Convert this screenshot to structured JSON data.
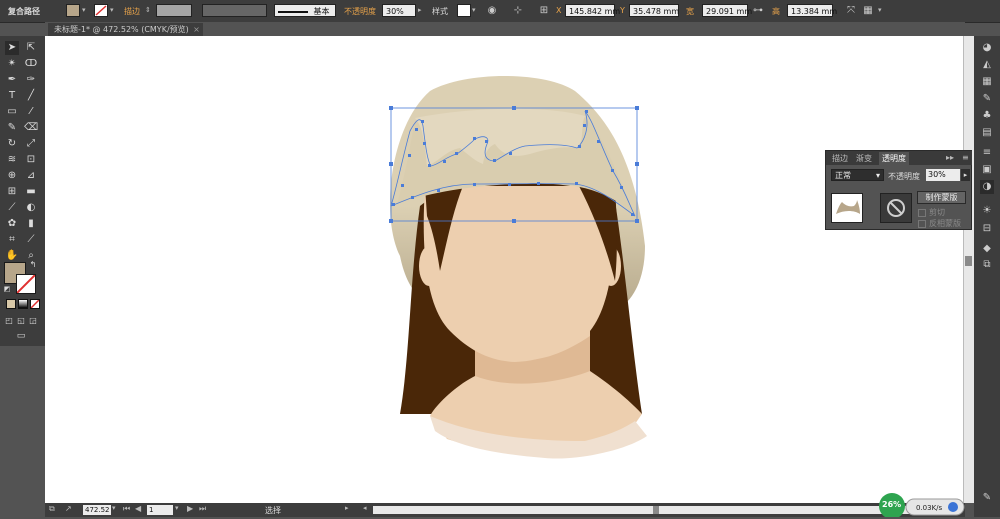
{
  "control_bar": {
    "object_type": "复合路径",
    "stroke_label": "描边",
    "basic_label": "基本",
    "opacity_label": "不透明度",
    "opacity_value": "30%",
    "style_label": "样式",
    "x_label": "X",
    "x_value": "145.842",
    "x_unit": "mm",
    "y_label": "Y",
    "y_value": "35.478",
    "y_unit": "mm",
    "w_label": "宽",
    "w_value": "29.091",
    "w_unit": "mm",
    "h_label": "高",
    "h_value": "13.384",
    "h_unit": "mm",
    "fill_color": "#b7a68a"
  },
  "document_tab": {
    "title": "未标题-1* @ 472.52% (CMYK/预览)",
    "close": "×"
  },
  "toolbar": {
    "fill_color": "#b7a68a",
    "tools": [
      "selection-tool",
      "direct-selection-tool",
      "magic-wand-tool",
      "lasso-tool",
      "pen-tool",
      "curvature-tool",
      "type-tool",
      "line-tool",
      "rectangle-tool",
      "paintbrush-tool",
      "pencil-tool",
      "eraser-tool",
      "rotate-tool",
      "scale-tool",
      "warp-tool",
      "free-transform-tool",
      "shape-builder-tool",
      "perspective-tool",
      "mesh-tool",
      "gradient-tool",
      "eyedropper-tool",
      "blend-tool",
      "symbol-sprayer-tool",
      "column-graph-tool",
      "artboard-tool",
      "slice-tool",
      "hand-tool",
      "zoom-tool"
    ]
  },
  "transparency_panel": {
    "tabs": [
      "描边",
      "渐变",
      "透明度"
    ],
    "active_tab": "透明度",
    "blend_mode": "正常",
    "opacity_label": "不透明度",
    "opacity_value": "30%",
    "make_mask": "制作蒙版",
    "clip": "剪切",
    "invert_mask": "反相蒙版"
  },
  "status_bar": {
    "zoom": "472.52",
    "artboard": "1",
    "tool_label": "选择"
  },
  "network_widget": {
    "percent": "26%",
    "speed": "0.03K/s"
  },
  "colors": {
    "hair": "#4a2708",
    "skin": "#edcfaf",
    "hat": "#dcd0b3",
    "hat_shade": "#b6a98c",
    "selection": "#4a7cd8",
    "accent_orange": "#e8a34a"
  }
}
